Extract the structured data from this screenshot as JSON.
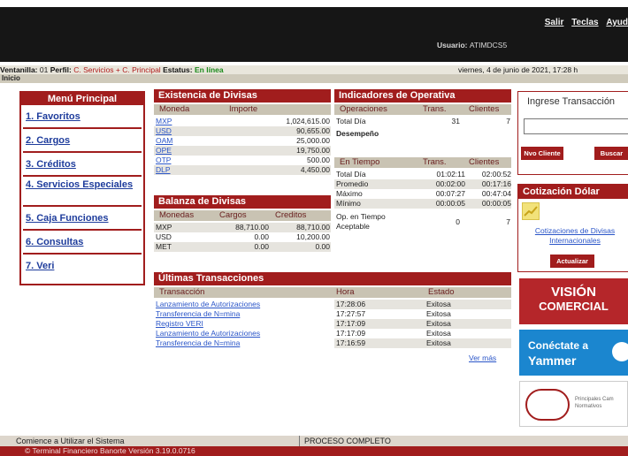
{
  "header": {
    "links": [
      "Salir",
      "Teclas",
      "Ayud"
    ],
    "user_label": "Usuario:",
    "user_value": "ATIMDCS5"
  },
  "status": {
    "ventanilla_label": "Ventanilla:",
    "ventanilla_value": "01",
    "perfil_label": "Perfil:",
    "perfil_value": "C. Servicios + C. Principal",
    "estatus_label": "Estatus:",
    "estatus_value": "En línea",
    "date": "viernes, 4 de junio de 2021, 17:28 h"
  },
  "breadcrumb": "Inicio",
  "menu": {
    "title": "Menú Principal",
    "items": [
      "1. Favoritos",
      "2. Cargos",
      "3. Créditos",
      "4. Servicios Especiales",
      "5. Caja Funciones",
      "6. Consultas",
      "7. Veri"
    ]
  },
  "existencia": {
    "title": "Existencia de Divisas",
    "headers": [
      "Moneda",
      "Importe"
    ],
    "rows": [
      [
        "MXP",
        "1,024,615.00"
      ],
      [
        "USD",
        "90,655.00"
      ],
      [
        "OAM",
        "25,000.00"
      ],
      [
        "OPE",
        "19,750.00"
      ],
      [
        "OTP",
        "500.00"
      ],
      [
        "DLP",
        "4,450.00"
      ]
    ]
  },
  "balanza": {
    "title": "Balanza de Divisas",
    "headers": [
      "Monedas",
      "Cargos",
      "Creditos"
    ],
    "rows": [
      [
        "MXP",
        "88,710.00",
        "88,710.00"
      ],
      [
        "USD",
        "0.00",
        "10,200.00"
      ],
      [
        "MET",
        "0.00",
        "0.00"
      ]
    ]
  },
  "indicadores": {
    "title": "Indicadores de Operativa",
    "headers": [
      "Operaciones",
      "Trans.",
      "Clientes"
    ],
    "total_row": [
      "Total Día",
      "31",
      "7"
    ],
    "desempeno": "Desempeño",
    "tiempo_headers": [
      "En Tiempo",
      "Trans.",
      "Clientes"
    ],
    "tiempo_rows": [
      [
        "Total Día",
        "01:02:11",
        "02:00:52"
      ],
      [
        "Promedio",
        "00:02:00",
        "00:17:16"
      ],
      [
        "Máximo",
        "00:07:27",
        "00:47:04"
      ],
      [
        "Mínimo",
        "00:00:05",
        "00:00:05"
      ]
    ],
    "op_label": "Op. en Tiempo Aceptable",
    "op_values": [
      "0",
      "7"
    ]
  },
  "ultimas": {
    "title": "Últimas Transacciones",
    "headers": [
      "Transacción",
      "Hora",
      "Estado"
    ],
    "rows": [
      [
        "Lanzamiento de Autorizaciones",
        "17:28:06",
        "Exitosa"
      ],
      [
        "Transferencia de N=mina",
        "17:27:57",
        "Exitosa"
      ],
      [
        "Registro VERI",
        "17:17:09",
        "Exitosa"
      ],
      [
        "Lanzamiento de Autorizaciones",
        "17:17:09",
        "Exitosa"
      ],
      [
        "Transferencia de N=mina",
        "17:16:59",
        "Exitosa"
      ]
    ],
    "more": "Ver más"
  },
  "sidebar": {
    "tx_title": "Ingrese Transacción",
    "btn_new": "Nvo Cliente",
    "btn_search": "Buscar",
    "usd_title": "Cotización Dólar",
    "usd_link": "Cotizaciones de Divisas Internacionales",
    "btn_update": "Actualizar",
    "banner1_line1": "VISIÓN",
    "banner1_line2": "COMERCIAL",
    "banner2_line1": "Conéctate a",
    "banner2_line2": "Yammer",
    "banner3_text": "Principales Cam Normativos"
  },
  "footer": {
    "left": "Comience a Utilizar el Sistema",
    "center": "PROCESO COMPLETO",
    "bottom": "© Terminal Financiero Banorte  Versión 3.19.0.0716"
  }
}
